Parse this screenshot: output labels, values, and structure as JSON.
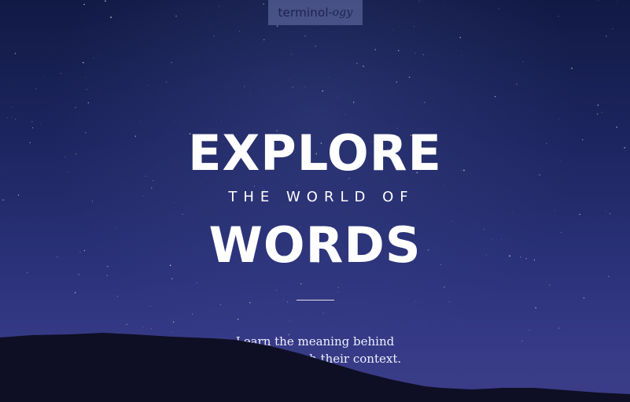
{
  "header": {
    "logo_main": "terminol",
    "logo_suffix": "-ogy"
  },
  "hero": {
    "headline_top": "EXPLORE",
    "headline_middle": "THE WORLD OF",
    "headline_bottom": "WORDS",
    "tagline_line1": "Learn the meaning behind",
    "tagline_line2": "words through their context."
  },
  "colors": {
    "sky_top": "#111a44",
    "sky_bottom": "#3b3d87",
    "hill": "#0e0f24",
    "text": "#ffffff"
  }
}
